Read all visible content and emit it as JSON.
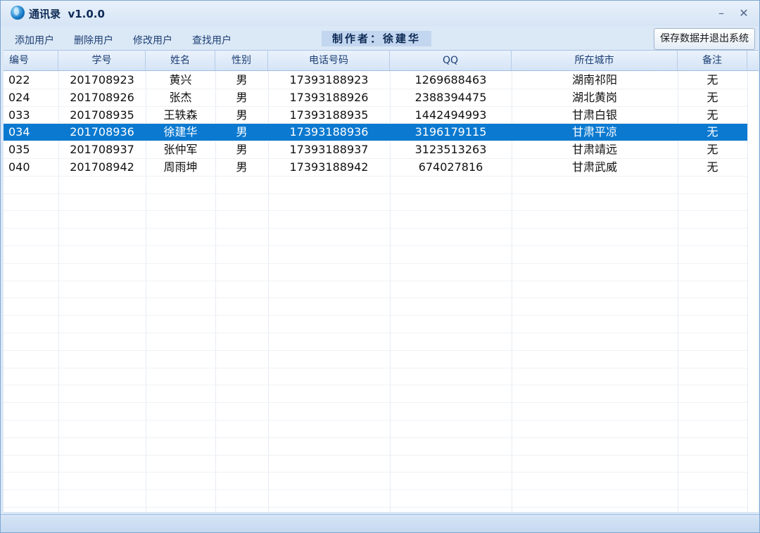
{
  "window": {
    "title": "通讯录  v1.0.0",
    "minimize": "–",
    "close": "✕"
  },
  "menu": {
    "items": [
      "添加用户",
      "删除用户",
      "修改用户",
      "查找用户"
    ],
    "author": "制作者：徐建华",
    "save_exit": "保存数据并退出系统"
  },
  "table": {
    "columns": [
      "编号",
      "学号",
      "姓名",
      "性别",
      "电话号码",
      "QQ",
      "所在城市",
      "备注"
    ],
    "rows": [
      [
        "022",
        "201708923",
        "黄兴",
        "男",
        "17393188923",
        "1269688463",
        "湖南祁阳",
        "无"
      ],
      [
        "024",
        "201708926",
        "张杰",
        "男",
        "17393188926",
        "2388394475",
        "湖北黄岗",
        "无"
      ],
      [
        "033",
        "201708935",
        "王轶森",
        "男",
        "17393188935",
        "1442494993",
        "甘肃白银",
        "无"
      ],
      [
        "034",
        "201708936",
        "徐建华",
        "男",
        "17393188936",
        "3196179115",
        "甘肃平凉",
        "无"
      ],
      [
        "035",
        "201708937",
        "张仲军",
        "男",
        "17393188937",
        "3123513263",
        "甘肃靖远",
        "无"
      ],
      [
        "040",
        "201708942",
        "周雨坤",
        "男",
        "17393188942",
        "674027816",
        "甘肃武威",
        "无"
      ]
    ],
    "selected_row": 3
  },
  "colors": {
    "accent": "#0b79d0",
    "header": "#d5e4f6",
    "window_frame": "#dbe8f6"
  },
  "icons": {
    "app": "globe-icon",
    "minimize": "minimize-icon",
    "close": "close-icon"
  }
}
